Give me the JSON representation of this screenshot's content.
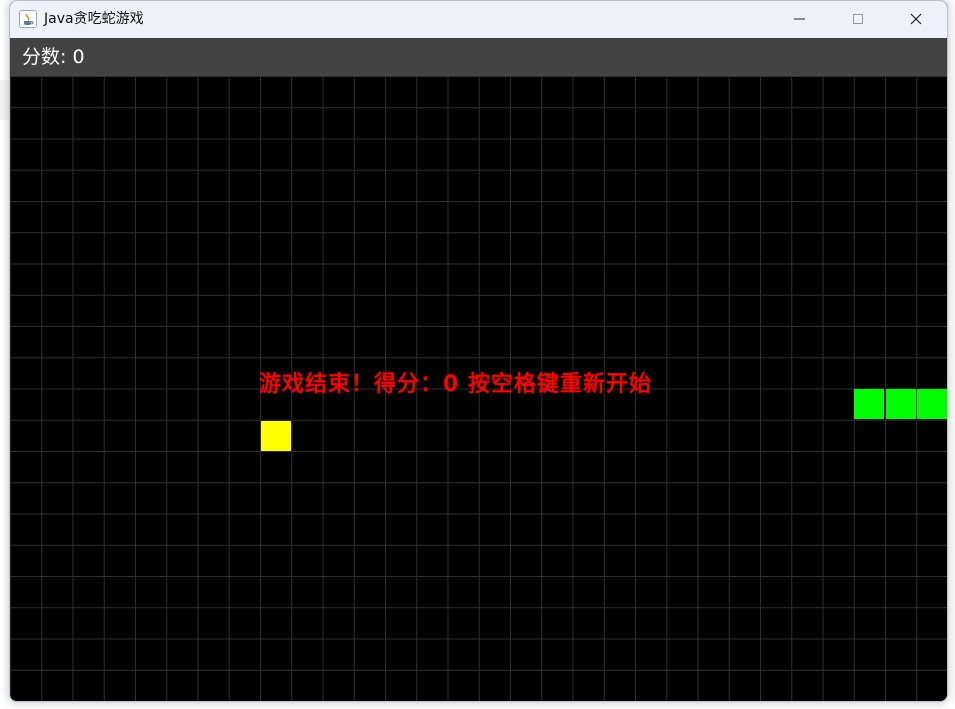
{
  "window": {
    "title": "Java贪吃蛇游戏",
    "icon": "java-app-icon",
    "controls": [
      "minimize-icon",
      "maximize-icon",
      "close-icon"
    ]
  },
  "score": {
    "label": "分数: 0"
  },
  "game": {
    "message": "游戏结束！得分：0 按空格键重新开始",
    "colors": {
      "background": "#000000",
      "grid_line": "#2f2f2f",
      "food": "#ffff00",
      "snake": "#00ff00",
      "message": "#ff0000",
      "score_bar": "#434343"
    }
  }
}
